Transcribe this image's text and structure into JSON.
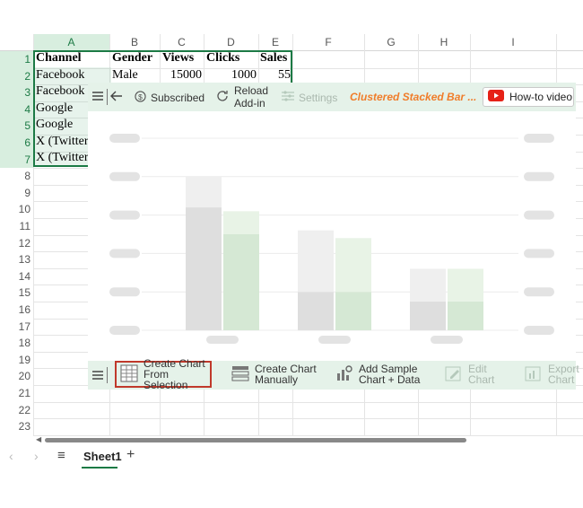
{
  "columns": [
    "A",
    "B",
    "C",
    "D",
    "E",
    "F",
    "G",
    "H",
    "I"
  ],
  "rows": [
    "1",
    "2",
    "3",
    "4",
    "5",
    "6",
    "7",
    "8",
    "9",
    "10",
    "11",
    "12",
    "13",
    "14",
    "15",
    "16",
    "17",
    "18",
    "19",
    "20",
    "21",
    "22",
    "23"
  ],
  "cells": {
    "headers": [
      "Channel",
      "Gender",
      "Views",
      "Clicks",
      "Sales"
    ],
    "row2": [
      "Facebook",
      "Male",
      "15000",
      "1000",
      "55"
    ],
    "a3": "Facebook",
    "a4": "Google",
    "a5": "Google",
    "a6": "X (Twitter",
    "a7": "X (Twitter"
  },
  "addin": {
    "subscribed": "Subscribed",
    "reload": "Reload\nAdd-in",
    "settings": "Settings",
    "chart_title": "Clustered Stacked Bar ...",
    "howto": "How-to video",
    "bottom": {
      "create_selection": "Create Chart\nFrom Selection",
      "create_manual": "Create Chart\nManually",
      "add_sample": "Add Sample\nChart + Data",
      "edit": "Edit\nChart",
      "export": "Export\nChart"
    }
  },
  "chart_data": {
    "type": "bar",
    "note_free": true,
    "groups": [
      {
        "bars": [
          {
            "bottom": 3.2,
            "top": 0.8,
            "color": "grey"
          },
          {
            "bottom": 2.5,
            "top": 0.6,
            "color": "green"
          }
        ]
      },
      {
        "bars": [
          {
            "bottom": 1.0,
            "top": 1.6,
            "color": "grey"
          },
          {
            "bottom": 1.0,
            "top": 1.4,
            "color": "green"
          }
        ]
      },
      {
        "bars": [
          {
            "bottom": 0.75,
            "top": 0.85,
            "color": "grey"
          },
          {
            "bottom": 0.75,
            "top": 0.85,
            "color": "green"
          }
        ]
      }
    ],
    "ylim": [
      0,
      5
    ]
  },
  "sheet": {
    "tab": "Sheet1",
    "add": "+",
    "menu": "≡"
  },
  "colors": {
    "accent": "#1c7a45",
    "addin_bg": "#e5f2e9",
    "title_orange": "#f07d2b",
    "youtube_red": "#e62117"
  }
}
